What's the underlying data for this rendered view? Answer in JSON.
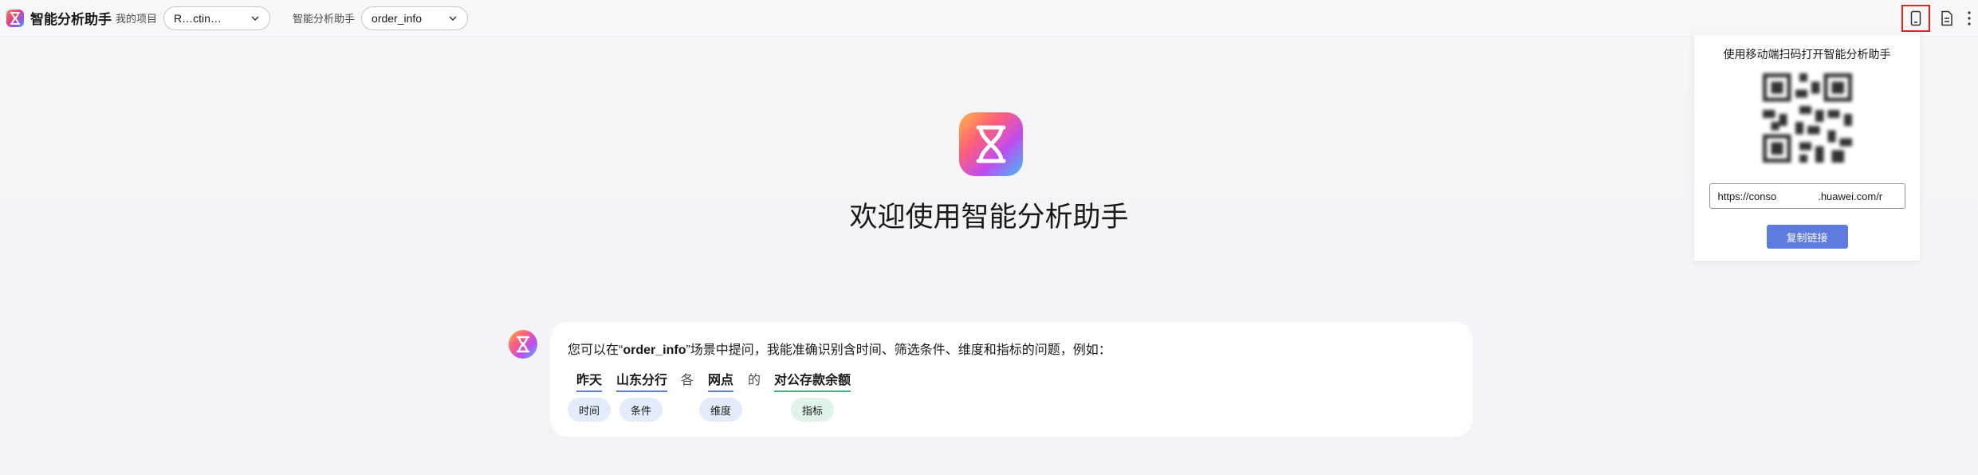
{
  "header": {
    "app_title": "智能分析助手",
    "project_label": "我的项目",
    "project_value": "R…ctin…",
    "assistant_label": "智能分析助手",
    "assistant_value": "order_info"
  },
  "popover": {
    "title": "使用移动端扫码打开智能分析助手",
    "url": "https://conso        .huawei.com/r",
    "copy_button": "复制链接"
  },
  "main": {
    "welcome": "欢迎使用智能分析助手"
  },
  "message": {
    "intro_prefix": "您可以在“",
    "intro_scene": "order_info",
    "intro_suffix": "”场景中提问，我能准确识别含时间、筛选条件、维度和指标的问题，例如：",
    "example": {
      "time": "昨天",
      "condition": "山东分行",
      "each": "各",
      "dimension": "网点",
      "of": "的",
      "metric": "对公存款余额"
    },
    "tags": {
      "time": "时间",
      "condition": "条件",
      "dimension": "维度",
      "metric": "指标"
    }
  },
  "colors": {
    "accent": "#5e7ce0",
    "metric_green": "#36b37e",
    "active_outline": "#e2231a"
  },
  "icons": {
    "mobile": "mobile-phone-icon",
    "document": "document-icon",
    "more": "more-vertical-icon"
  }
}
